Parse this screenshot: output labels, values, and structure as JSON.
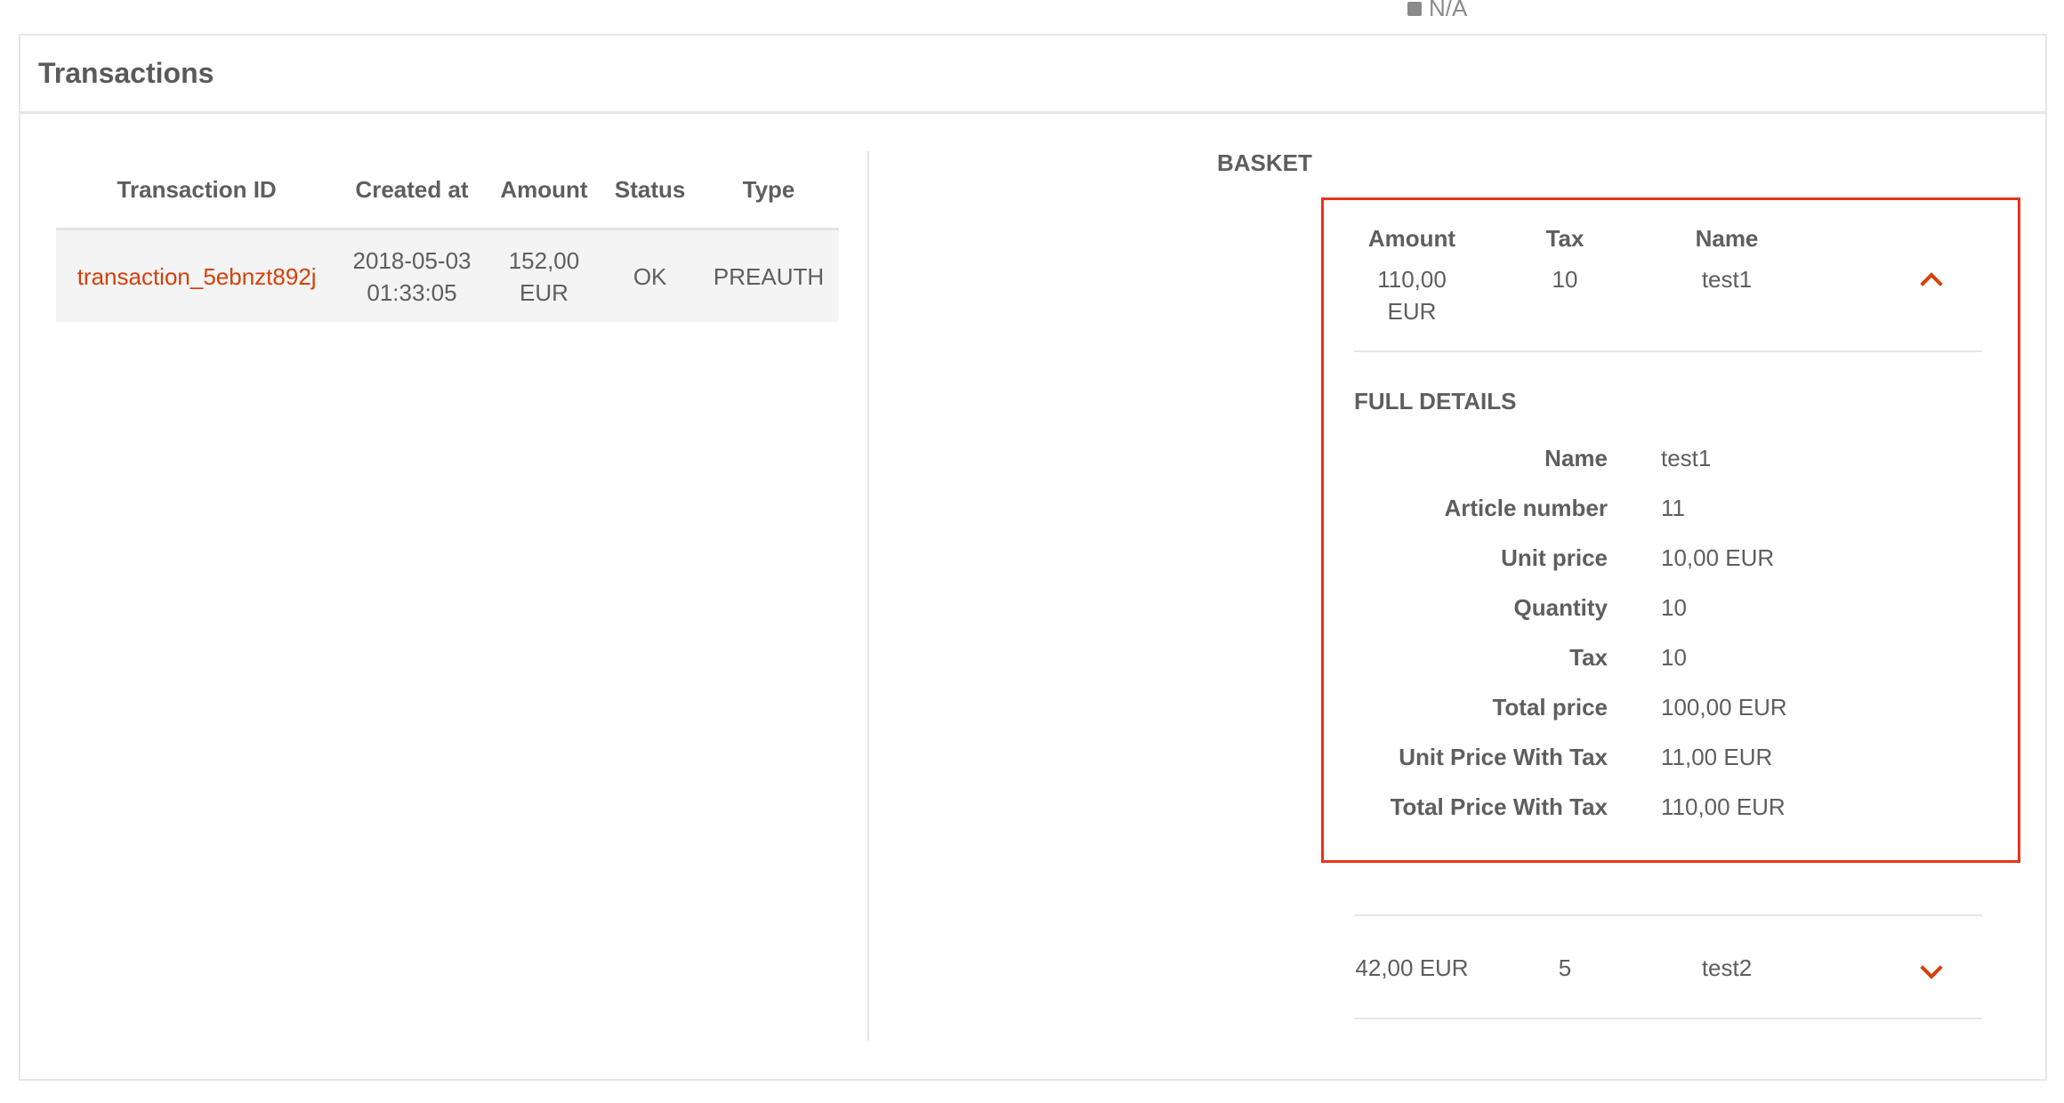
{
  "top_stub": {
    "text": "N/A"
  },
  "panel": {
    "title": "Transactions"
  },
  "transactions": {
    "headers": [
      "Transaction ID",
      "Created at",
      "Amount",
      "Status",
      "Type"
    ],
    "rows": [
      {
        "id": "transaction_5ebnzt892j",
        "created_date": "2018-05-03",
        "created_time": "01:33:05",
        "amount_value": "152,00",
        "amount_currency": "EUR",
        "status": "OK",
        "type": "PREAUTH"
      }
    ]
  },
  "basket": {
    "label": "BASKET",
    "headers": {
      "amount": "Amount",
      "tax": "Tax",
      "name": "Name"
    },
    "items": [
      {
        "amount_value": "110,00",
        "amount_currency": "EUR",
        "tax": "10",
        "name": "test1",
        "expanded": true,
        "full_details_title": "FULL DETAILS",
        "details": [
          {
            "label": "Name",
            "value": "test1"
          },
          {
            "label": "Article number",
            "value": "11"
          },
          {
            "label": "Unit price",
            "value": "10,00 EUR"
          },
          {
            "label": "Quantity",
            "value": "10"
          },
          {
            "label": "Tax",
            "value": "10"
          },
          {
            "label": "Total price",
            "value": "100,00 EUR"
          },
          {
            "label": "Unit Price With Tax",
            "value": "11,00 EUR"
          },
          {
            "label": "Total Price With Tax",
            "value": "110,00 EUR"
          }
        ]
      },
      {
        "amount": "42,00 EUR",
        "tax": "5",
        "name": "test2",
        "expanded": false
      }
    ]
  },
  "colors": {
    "accent": "#d6400c",
    "highlight_border": "#e8331c",
    "text": "#5e5e5e",
    "border": "#e6e6e6",
    "row_bg": "#f4f4f4"
  }
}
